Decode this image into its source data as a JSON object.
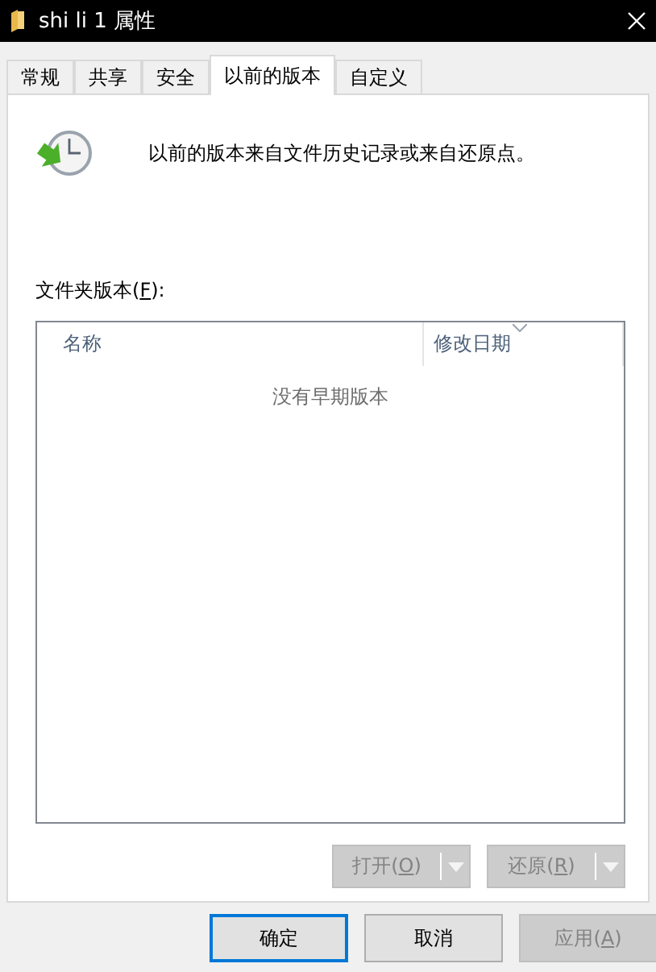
{
  "window": {
    "title": "shi li 1 属性"
  },
  "tabs": [
    {
      "label": "常规",
      "selected": false
    },
    {
      "label": "共享",
      "selected": false
    },
    {
      "label": "安全",
      "selected": false
    },
    {
      "label": "以前的版本",
      "selected": true
    },
    {
      "label": "自定义",
      "selected": false
    }
  ],
  "description": "以前的版本来自文件历史记录或来自还原点。",
  "versions_label": {
    "before": "文件夹版本(",
    "access_key": "F",
    "after": "):"
  },
  "table": {
    "columns": [
      {
        "label": "名称",
        "sorted": false
      },
      {
        "label": "修改日期",
        "sorted": true
      }
    ],
    "empty_text": "没有早期版本"
  },
  "actions": [
    {
      "before": "打开(",
      "access_key": "O",
      "after": ")",
      "disabled": true
    },
    {
      "before": "还原(",
      "access_key": "R",
      "after": ")",
      "disabled": true
    }
  ],
  "buttons": [
    {
      "text": "确定",
      "default": true,
      "disabled": false
    },
    {
      "text": "取消",
      "default": false,
      "disabled": false
    },
    {
      "before": "应用(",
      "access_key": "A",
      "after": ")",
      "default": false,
      "disabled": true
    }
  ]
}
